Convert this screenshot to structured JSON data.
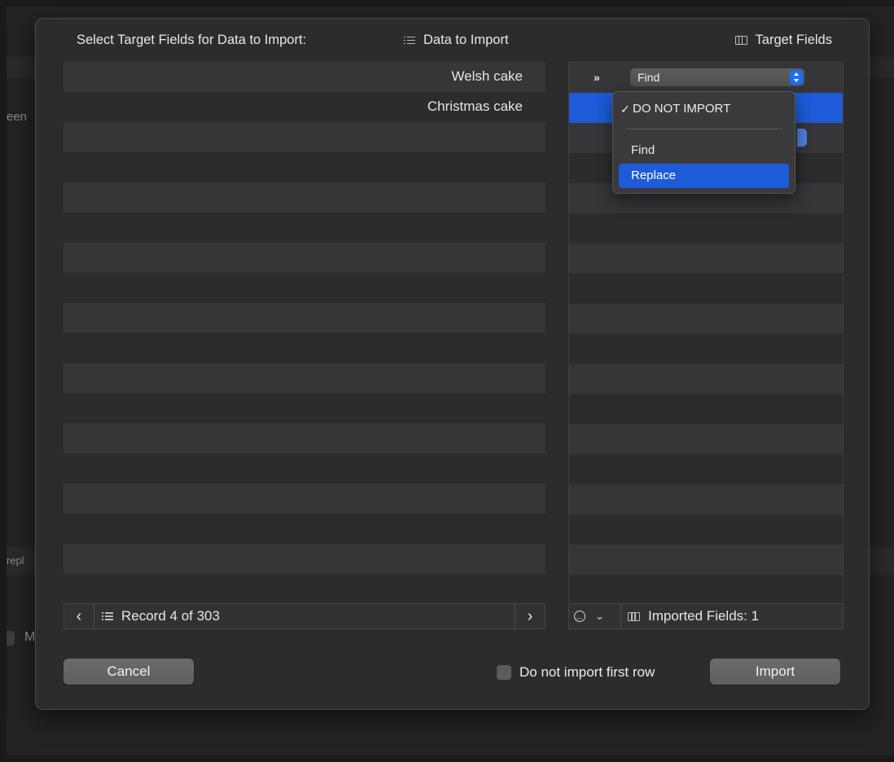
{
  "background": {
    "left_text_top": "een",
    "left_text_mid": "repl",
    "left_text_bottom": "M"
  },
  "header": {
    "title": "Select Target Fields for Data to Import:",
    "data_label": "Data to Import",
    "target_label": "Target Fields"
  },
  "data_rows": [
    "Welsh cake",
    "Christmas cake"
  ],
  "target_field": {
    "popup_value": "Find"
  },
  "dropdown": {
    "items": [
      {
        "label": "DO NOT IMPORT",
        "checked": true
      },
      {
        "label": "Find"
      },
      {
        "label": "Replace",
        "highlighted": true
      }
    ]
  },
  "footer": {
    "record_text": "Record 4 of 303",
    "imported_text": "Imported Fields: 1"
  },
  "buttons": {
    "cancel": "Cancel",
    "import": "Import"
  },
  "checkbox": {
    "label": "Do not import first row",
    "checked": false
  },
  "colors": {
    "accent": "#1e5bd8",
    "sheet": "#2c2c2e"
  }
}
